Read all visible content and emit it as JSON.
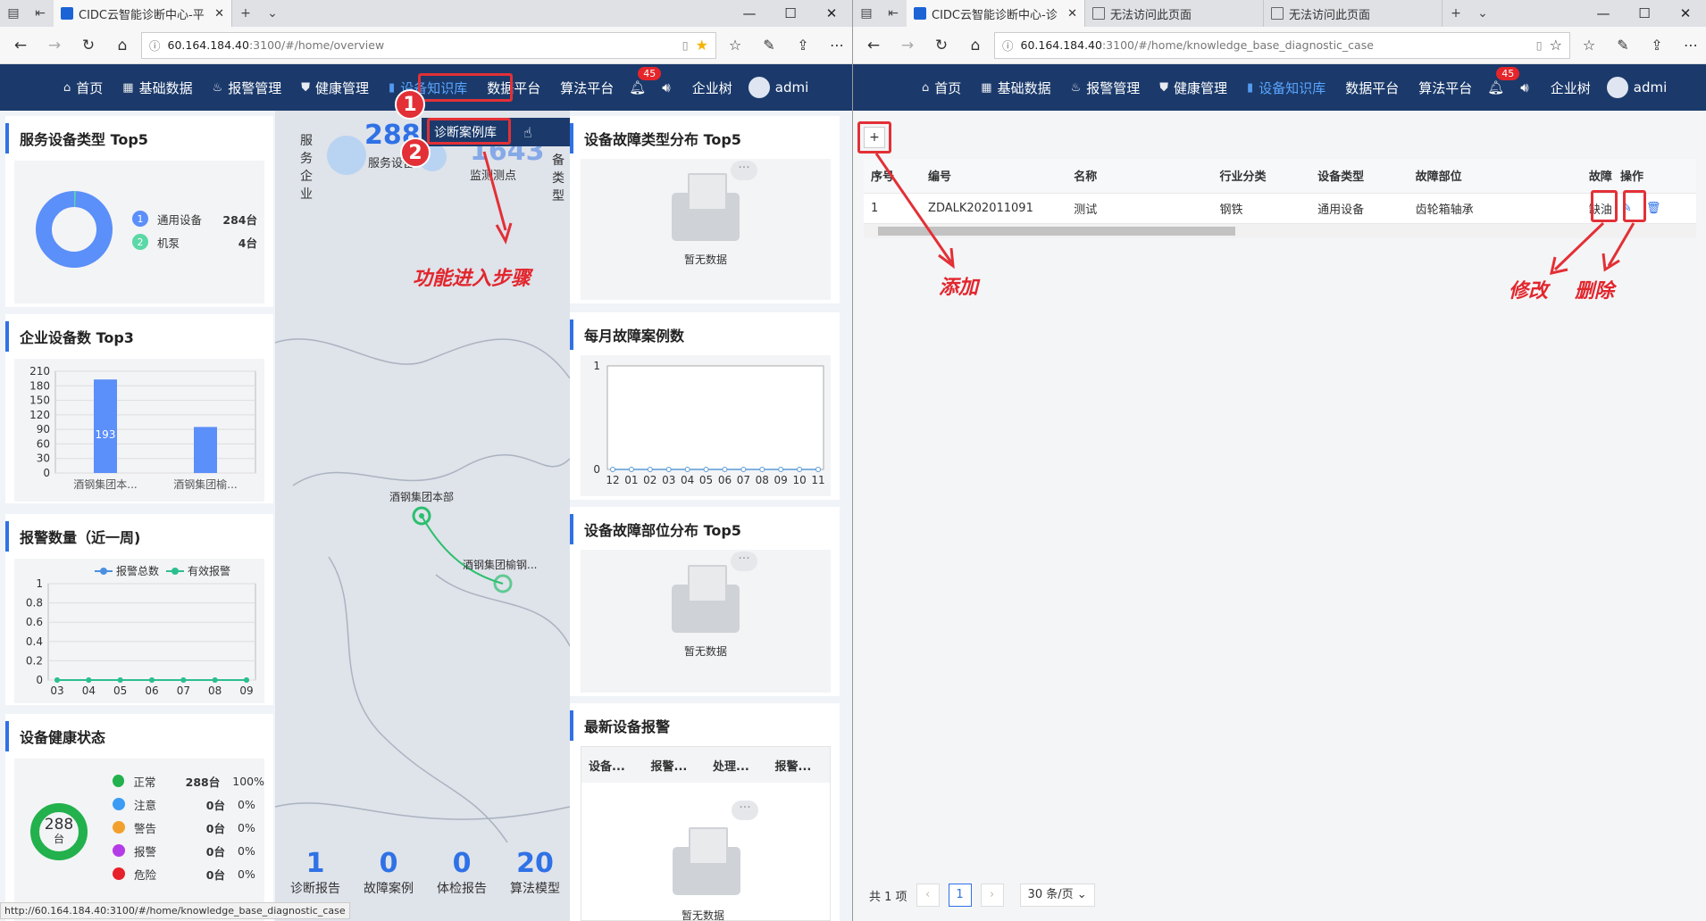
{
  "left": {
    "tab_title": "CIDC云智能诊断中心-平",
    "url_host": "60.164.184.40",
    "url_path": ":3100/#/home/overview",
    "nav": [
      {
        "icon": "home-icon",
        "label": "首页"
      },
      {
        "icon": "grid-icon",
        "label": "基础数据"
      },
      {
        "icon": "bell-alarm-icon",
        "label": "报警管理"
      },
      {
        "icon": "shield-icon",
        "label": "健康管理"
      },
      {
        "icon": "book-icon",
        "label": "设备知识库"
      },
      {
        "icon": "",
        "label": "数据平台"
      },
      {
        "icon": "",
        "label": "算法平台"
      }
    ],
    "badge": "45",
    "company": "企业树",
    "user": "admi",
    "dropdown_item": "诊断案例库",
    "annotation_text": "功能进入步骤",
    "step1": "1",
    "step2": "2",
    "service_top5": {
      "title": "服务设备类型 Top5",
      "items": [
        {
          "idx": "1",
          "name": "通用设备",
          "count": "284台",
          "color": "#5b8ff9"
        },
        {
          "idx": "2",
          "name": "机泵",
          "count": "4台",
          "color": "#5ad8a6"
        }
      ]
    },
    "company_top3": {
      "title": "企业设备数 Top3"
    },
    "alarm_week": {
      "title": "报警数量（近一周)"
    },
    "health": {
      "title": "设备健康状态",
      "center": "288",
      "center_unit": "台",
      "rows": [
        {
          "name": "正常",
          "count": "288台",
          "pct": "100%",
          "color": "#22b14c"
        },
        {
          "name": "注意",
          "count": "0台",
          "pct": "0%",
          "color": "#3b9cf5"
        },
        {
          "name": "警告",
          "count": "0台",
          "pct": "0%",
          "color": "#f2a02c"
        },
        {
          "name": "报警",
          "count": "0台",
          "pct": "0%",
          "color": "#b43ce6"
        },
        {
          "name": "危险",
          "count": "0台",
          "pct": "0%",
          "color": "#e6212a"
        }
      ]
    },
    "center": {
      "v_label": "服务企业",
      "v_label2": "备类型",
      "stat1_num": "288",
      "stat1_label": "服务设备",
      "stat2_num": "1643",
      "stat2_label": "监测测点",
      "map_label1": "酒钢集团本部",
      "map_label2": "酒钢集团榆钢...",
      "bottom": [
        {
          "num": "1",
          "label": "诊断报告"
        },
        {
          "num": "0",
          "label": "故障案例"
        },
        {
          "num": "0",
          "label": "体检报告"
        },
        {
          "num": "20",
          "label": "算法模型"
        }
      ]
    },
    "fault_type_top5": {
      "title": "设备故障类型分布 Top5",
      "empty": "暂无数据"
    },
    "monthly_cases": {
      "title": "每月故障案例数"
    },
    "fault_part_top5": {
      "title": "设备故障部位分布 Top5",
      "empty": "暂无数据"
    },
    "latest_alarm": {
      "title": "最新设备报警",
      "cols": [
        "设备...",
        "报警...",
        "处理...",
        "报警..."
      ],
      "empty": "暂无数据"
    },
    "status_url": "http://60.164.184.40:3100/#/home/knowledge_base_diagnostic_case"
  },
  "right": {
    "tabs": [
      "CIDC云智能诊断中心-诊",
      "无法访问此页面",
      "无法访问此页面"
    ],
    "url_host": "60.164.184.40",
    "url_path": ":3100/#/home/knowledge_base_diagnostic_case",
    "nav": [
      {
        "icon": "home-icon",
        "label": "首页"
      },
      {
        "icon": "grid-icon",
        "label": "基础数据"
      },
      {
        "icon": "bell-alarm-icon",
        "label": "报警管理"
      },
      {
        "icon": "shield-icon",
        "label": "健康管理"
      },
      {
        "icon": "book-icon",
        "label": "设备知识库"
      },
      {
        "icon": "",
        "label": "数据平台"
      },
      {
        "icon": "",
        "label": "算法平台"
      }
    ],
    "badge": "45",
    "company": "企业树",
    "user": "admi",
    "add_btn": "+",
    "table": {
      "headers": [
        "序号",
        "编号",
        "名称",
        "行业分类",
        "设备类型",
        "故障部位",
        "故障",
        "操作"
      ],
      "rows": [
        [
          "1",
          "ZDALK202011091",
          "测试",
          "钢铁",
          "通用设备",
          "齿轮箱轴承",
          "缺油"
        ]
      ]
    },
    "annot_add": "添加",
    "annot_edit": "修改",
    "annot_delete": "删除",
    "pager": {
      "total": "共 1 项",
      "page": "1",
      "size": "30 条/页"
    }
  },
  "chart_data": [
    {
      "type": "pie",
      "title": "服务设备类型 Top5",
      "categories": [
        "通用设备",
        "机泵"
      ],
      "values": [
        284,
        4
      ]
    },
    {
      "type": "bar",
      "title": "企业设备数 Top3",
      "categories": [
        "酒钢集团本...",
        "酒钢集团榆..."
      ],
      "values": [
        193,
        95
      ],
      "ylim": [
        0,
        210
      ],
      "yticks": [
        0,
        30,
        60,
        90,
        120,
        150,
        180,
        210
      ]
    },
    {
      "type": "line",
      "title": "报警数量（近一周)",
      "x": [
        "03",
        "04",
        "05",
        "06",
        "07",
        "08",
        "09"
      ],
      "series": [
        {
          "name": "报警总数",
          "values": [
            0,
            0,
            0,
            0,
            0,
            0,
            0
          ],
          "color": "#4a90e2"
        },
        {
          "name": "有效报警",
          "values": [
            0,
            0,
            0,
            0,
            0,
            0,
            0
          ],
          "color": "#2bbf8e"
        }
      ],
      "ylim": [
        0,
        1
      ],
      "yticks": [
        "0",
        "0.2",
        "0.4",
        "0.6",
        "0.8",
        "1"
      ]
    },
    {
      "type": "line",
      "title": "每月故障案例数",
      "x": [
        "12",
        "01",
        "02",
        "03",
        "04",
        "05",
        "06",
        "07",
        "08",
        "09",
        "10",
        "11"
      ],
      "series": [
        {
          "values": [
            0,
            0,
            0,
            0,
            0,
            0,
            0,
            0,
            0,
            0,
            0,
            0
          ],
          "color": "#5b9bd5"
        }
      ],
      "ylim": [
        0,
        1
      ],
      "yticks": [
        "0",
        "1"
      ]
    }
  ]
}
